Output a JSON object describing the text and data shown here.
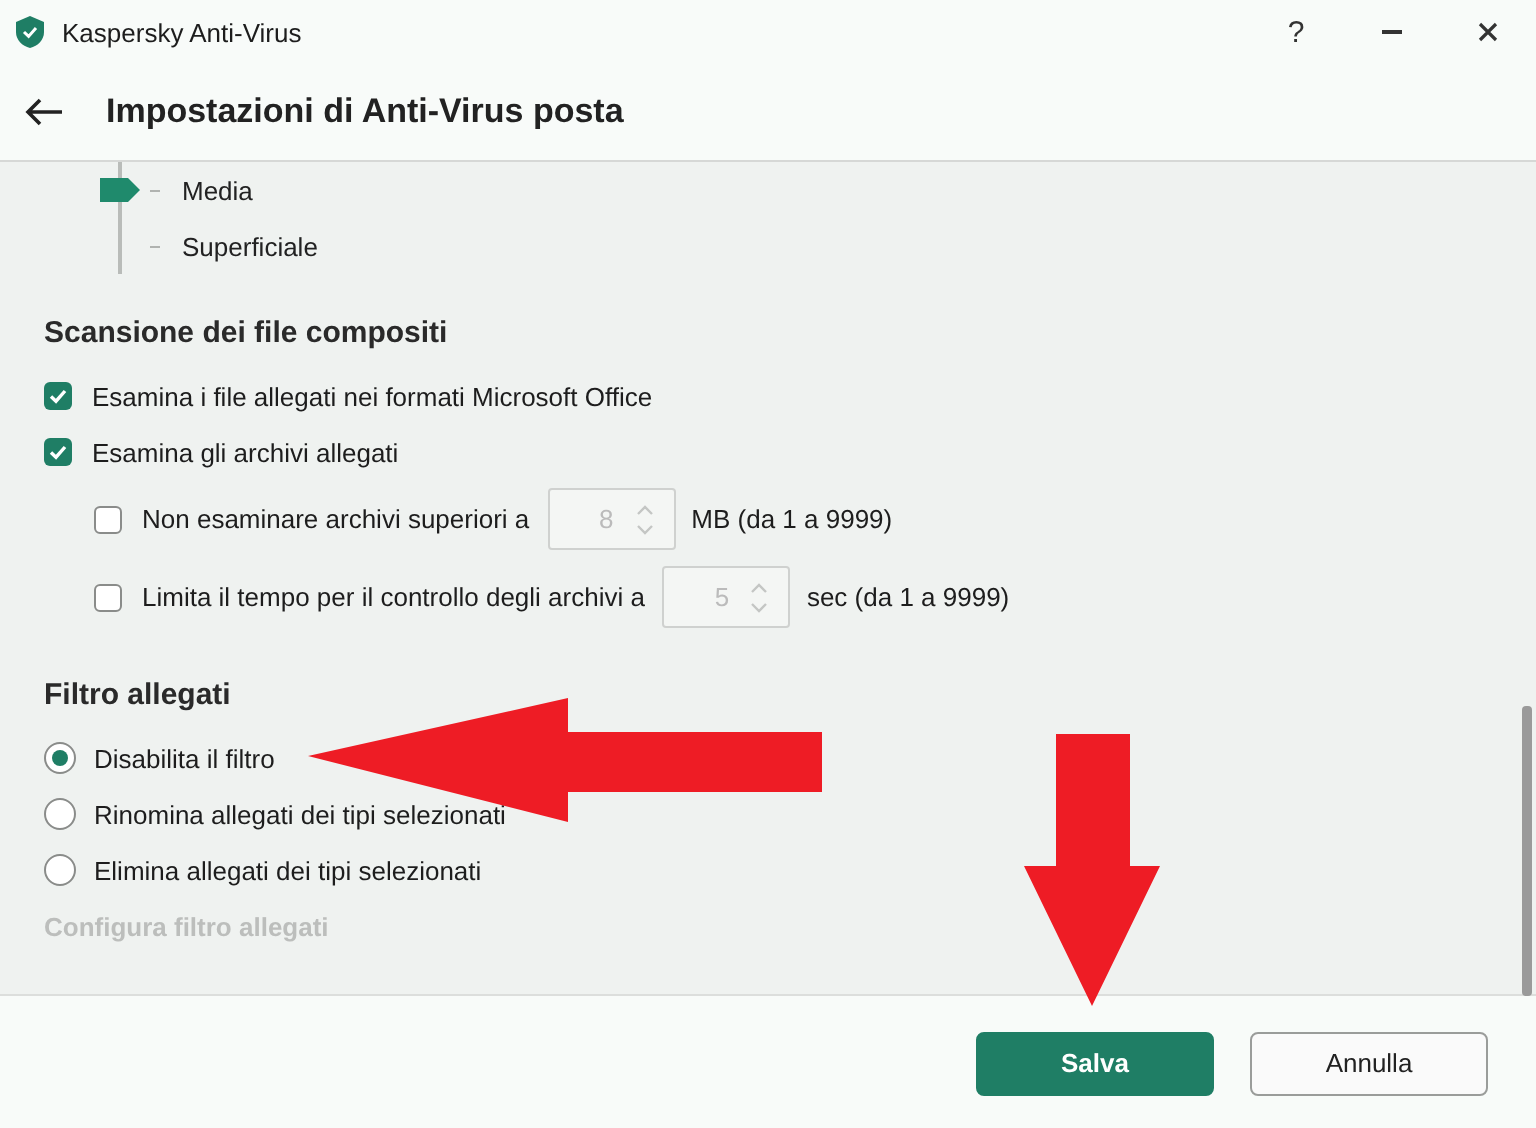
{
  "window": {
    "title": "Kaspersky Anti-Virus",
    "help": "?"
  },
  "page": {
    "title": "Impostazioni di Anti-Virus posta"
  },
  "level_scale": {
    "levels": [
      {
        "label": "Media",
        "selected": true
      },
      {
        "label": "Superficiale",
        "selected": false
      }
    ]
  },
  "sections": [
    {
      "title": "Scansione dei file compositi",
      "items": [
        {
          "kind": "checkbox",
          "label": "Esamina i file allegati nei formati Microsoft Office",
          "checked": true
        },
        {
          "kind": "checkbox",
          "label": "Esamina gli archivi allegati",
          "checked": true
        },
        {
          "kind": "limit",
          "label": "Non esaminare archivi superiori a",
          "checked": false,
          "value": "8",
          "unit": "MB (da 1 a 9999)",
          "disabled": true
        },
        {
          "kind": "limit",
          "label": "Limita il tempo per il controllo degli archivi a",
          "checked": false,
          "value": "5",
          "unit": "sec (da 1 a 9999)",
          "disabled": true
        }
      ]
    },
    {
      "title": "Filtro allegati",
      "items": [
        {
          "kind": "radio",
          "label": "Disabilita il filtro",
          "selected": true
        },
        {
          "kind": "radio",
          "label": "Rinomina allegati dei tipi selezionati",
          "selected": false
        },
        {
          "kind": "radio",
          "label": "Elimina allegati dei tipi selezionati",
          "selected": false
        },
        {
          "kind": "link",
          "label": "Configura filtro allegati",
          "disabled": true
        }
      ]
    }
  ],
  "footer": {
    "buttons": [
      {
        "label": "Salva",
        "kind": "primary"
      },
      {
        "label": "Annulla",
        "kind": "secondary"
      }
    ]
  },
  "annotations": [
    {
      "kind": "arrow-left"
    },
    {
      "kind": "arrow-down"
    }
  ]
}
